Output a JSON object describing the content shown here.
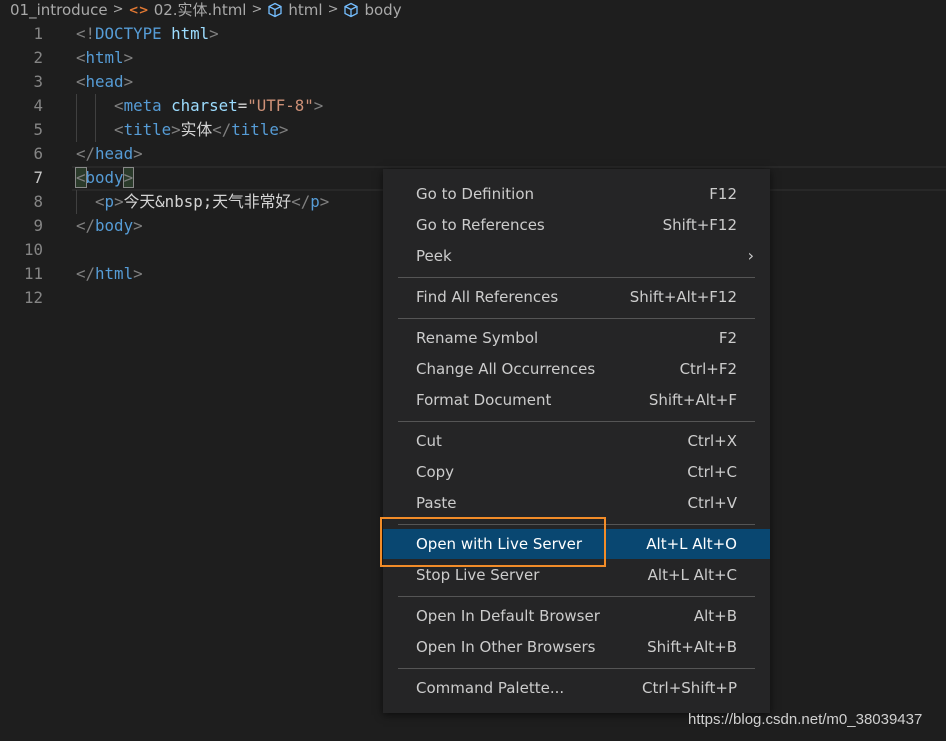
{
  "breadcrumb": {
    "folder": "01_introduce",
    "file": "02.实体.html",
    "symbols": [
      "html",
      "body"
    ]
  },
  "editor": {
    "current_line": 7,
    "lines": [
      {
        "n": "1",
        "tokens": [
          [
            "<!",
            "p"
          ],
          [
            "DOCTYPE",
            "t"
          ],
          [
            " ",
            "x"
          ],
          [
            "html",
            "a"
          ],
          [
            ">",
            "p"
          ]
        ]
      },
      {
        "n": "2",
        "tokens": [
          [
            "<",
            "p"
          ],
          [
            "html",
            "t"
          ],
          [
            ">",
            "p"
          ]
        ]
      },
      {
        "n": "3",
        "tokens": [
          [
            "<",
            "p"
          ],
          [
            "head",
            "t"
          ],
          [
            ">",
            "p"
          ]
        ]
      },
      {
        "n": "4",
        "tokens": [
          [
            "    ",
            "x"
          ],
          [
            "<",
            "p"
          ],
          [
            "meta",
            "t"
          ],
          [
            " ",
            "x"
          ],
          [
            "charset",
            "a"
          ],
          [
            "=",
            "x"
          ],
          [
            "\"UTF-8\"",
            "s"
          ],
          [
            ">",
            "p"
          ]
        ]
      },
      {
        "n": "5",
        "tokens": [
          [
            "    ",
            "x"
          ],
          [
            "<",
            "p"
          ],
          [
            "title",
            "t"
          ],
          [
            ">",
            "p"
          ],
          [
            "实体",
            "x"
          ],
          [
            "</",
            "p"
          ],
          [
            "title",
            "t"
          ],
          [
            ">",
            "p"
          ]
        ]
      },
      {
        "n": "6",
        "tokens": [
          [
            "</",
            "p"
          ],
          [
            "head",
            "t"
          ],
          [
            ">",
            "p"
          ]
        ]
      },
      {
        "n": "7",
        "tokens": [
          [
            "<",
            "p bm"
          ],
          [
            "body",
            "t"
          ],
          [
            ">",
            "p bm"
          ]
        ]
      },
      {
        "n": "8",
        "tokens": [
          [
            "  ",
            "x"
          ],
          [
            "<",
            "p"
          ],
          [
            "p",
            "t"
          ],
          [
            ">",
            "p"
          ],
          [
            "今天&nbsp;天气非常好",
            "x"
          ],
          [
            "</",
            "p"
          ],
          [
            "p",
            "t"
          ],
          [
            ">",
            "p"
          ]
        ]
      },
      {
        "n": "9",
        "tokens": [
          [
            "</",
            "p"
          ],
          [
            "body",
            "t"
          ],
          [
            ">",
            "p"
          ]
        ]
      },
      {
        "n": "10",
        "tokens": []
      },
      {
        "n": "11",
        "tokens": [
          [
            "</",
            "p"
          ],
          [
            "html",
            "t"
          ],
          [
            ">",
            "p"
          ]
        ]
      },
      {
        "n": "12",
        "tokens": []
      }
    ]
  },
  "context_menu": {
    "groups": [
      [
        {
          "label": "Go to Definition",
          "shortcut": "F12"
        },
        {
          "label": "Go to References",
          "shortcut": "Shift+F12"
        },
        {
          "label": "Peek",
          "shortcut": "",
          "submenu": true
        }
      ],
      [
        {
          "label": "Find All References",
          "shortcut": "Shift+Alt+F12"
        }
      ],
      [
        {
          "label": "Rename Symbol",
          "shortcut": "F2"
        },
        {
          "label": "Change All Occurrences",
          "shortcut": "Ctrl+F2"
        },
        {
          "label": "Format Document",
          "shortcut": "Shift+Alt+F"
        }
      ],
      [
        {
          "label": "Cut",
          "shortcut": "Ctrl+X"
        },
        {
          "label": "Copy",
          "shortcut": "Ctrl+C"
        },
        {
          "label": "Paste",
          "shortcut": "Ctrl+V"
        }
      ],
      [
        {
          "label": "Open with Live Server",
          "shortcut": "Alt+L Alt+O",
          "highlighted": true
        },
        {
          "label": "Stop Live Server",
          "shortcut": "Alt+L Alt+C"
        }
      ],
      [
        {
          "label": "Open In Default Browser",
          "shortcut": "Alt+B"
        },
        {
          "label": "Open In Other Browsers",
          "shortcut": "Shift+Alt+B"
        }
      ],
      [
        {
          "label": "Command Palette...",
          "shortcut": "Ctrl+Shift+P"
        }
      ]
    ]
  },
  "colors": {
    "highlight": "#094771",
    "annotation_box": "#f28c28",
    "menu_bg": "#252526",
    "editor_bg": "#1e1e1e"
  },
  "watermark": "https://blog.csdn.net/m0_38039437"
}
